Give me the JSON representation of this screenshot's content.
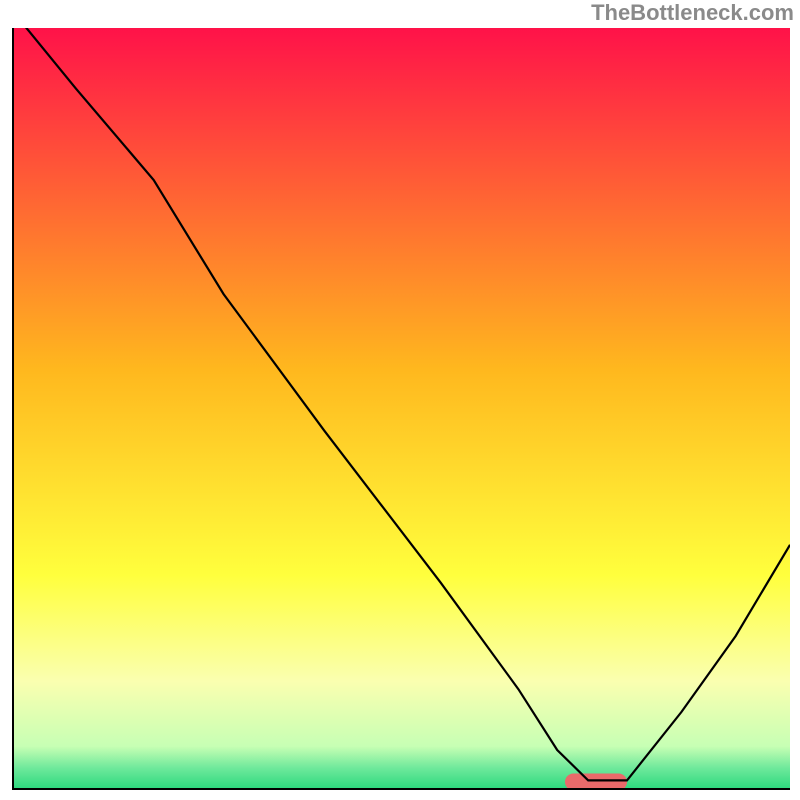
{
  "attribution": "TheBottleneck.com",
  "chart_data": {
    "type": "line",
    "title": "",
    "xlabel": "",
    "ylabel": "",
    "xlim": [
      0,
      100
    ],
    "ylim": [
      0,
      100
    ],
    "grid": false,
    "legend": false,
    "gradient_stops": [
      {
        "pos": 0.0,
        "color": "#ff1249"
      },
      {
        "pos": 0.45,
        "color": "#ffb81e"
      },
      {
        "pos": 0.72,
        "color": "#ffff3d"
      },
      {
        "pos": 0.86,
        "color": "#faffb0"
      },
      {
        "pos": 0.945,
        "color": "#c7ffb4"
      },
      {
        "pos": 0.975,
        "color": "#6be89a"
      },
      {
        "pos": 1.0,
        "color": "#2fd97f"
      }
    ],
    "series": [
      {
        "name": "bottleneck-curve",
        "color": "#000000",
        "width": 2.2,
        "x": [
          0,
          8,
          18,
          27,
          40,
          55,
          65,
          70,
          74,
          79,
          86,
          93,
          100
        ],
        "values": [
          102,
          92,
          80,
          65,
          47,
          27,
          13,
          5,
          1,
          1,
          10,
          20,
          32
        ]
      }
    ],
    "marker": {
      "name": "optimal-range-marker",
      "color": "#e96a6a",
      "x": 75,
      "y": 0.8,
      "w": 8,
      "h": 2.2,
      "rx": 1.1
    }
  }
}
